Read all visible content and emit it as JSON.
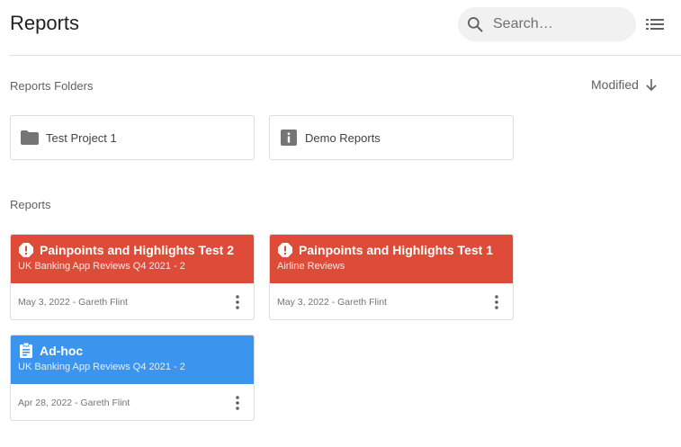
{
  "header": {
    "title": "Reports",
    "search_placeholder": "Search…",
    "search_icon": "search-icon",
    "view_toggle_icon": "list-view-icon"
  },
  "folders_section": {
    "label": "Reports Folders",
    "sort_label": "Modified",
    "sort_icon": "arrow-down-icon",
    "folders": [
      {
        "name": "Test Project 1",
        "icon": "folder-icon"
      },
      {
        "name": "Demo Reports",
        "icon": "info-icon"
      }
    ]
  },
  "reports_section": {
    "label": "Reports",
    "cards": [
      {
        "title": "Painpoints and Highlights Test 2",
        "subtitle": "UK Banking App Reviews Q4 2021 - 2",
        "meta": "May 3, 2022 - Gareth Flint",
        "icon": "alert-icon",
        "color": "#de4b39"
      },
      {
        "title": "Painpoints and Highlights Test 1",
        "subtitle": "Airline Reviews",
        "meta": "May 3, 2022 - Gareth Flint",
        "icon": "alert-icon",
        "color": "#de4b39"
      },
      {
        "title": "Ad-hoc",
        "subtitle": "UK Banking App Reviews Q4 2021 - 2",
        "meta": "Apr 28, 2022 - Gareth Flint",
        "icon": "clipboard-icon",
        "color": "#3b94ee"
      }
    ]
  },
  "colors": {
    "alert_red": "#de4b39",
    "adhoc_blue": "#3b94ee",
    "folder_icon": "#757575"
  }
}
